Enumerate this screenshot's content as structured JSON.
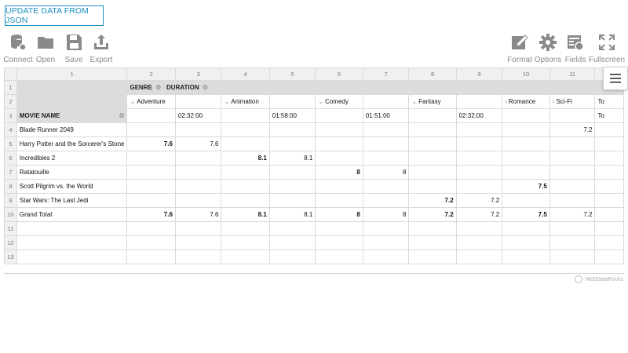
{
  "update_button": "UPDATE DATA FROM JSON",
  "toolbar": {
    "connect": "Connect",
    "open": "Open",
    "save": "Save",
    "export": "Export",
    "format": "Format",
    "options": "Options",
    "fields": "Fields",
    "fullscreen": "Fullscreen"
  },
  "column_numbers": [
    "1",
    "2",
    "3",
    "4",
    "5",
    "6",
    "7",
    "8",
    "9",
    "10",
    "11"
  ],
  "row_numbers": [
    "1",
    "2",
    "3",
    "4",
    "5",
    "6",
    "7",
    "8",
    "9",
    "10",
    "11",
    "12",
    "13"
  ],
  "header": {
    "col_field_genre": "GENRE",
    "col_field_duration": "DURATION",
    "row_field": "MOVIE NAME",
    "total_label_partial": "To"
  },
  "genres": [
    "Adventure",
    "Animation",
    "Comedy",
    "Fantasy",
    "Romance",
    "Sci-Fi"
  ],
  "durations": [
    "02:32:00",
    "01:58:00",
    "01:51:00",
    "02:32:00"
  ],
  "rows": [
    {
      "name": "Blade Runner 2049",
      "cells": [
        "",
        "",
        "",
        "",
        "",
        "",
        "",
        "",
        "",
        "7.2"
      ]
    },
    {
      "name": "Harry Potter and the Sorcerer's Stone",
      "cells": [
        "7.6",
        "7.6",
        "",
        "",
        "",
        "",
        "",
        "",
        "",
        ""
      ]
    },
    {
      "name": "Incredibles 2",
      "cells": [
        "",
        "",
        "8.1",
        "8.1",
        "",
        "",
        "",
        "",
        "",
        ""
      ]
    },
    {
      "name": "Ratatouille",
      "cells": [
        "",
        "",
        "",
        "",
        "8",
        "8",
        "",
        "",
        "",
        ""
      ]
    },
    {
      "name": "Scott Pilgrim vs. the World",
      "cells": [
        "",
        "",
        "",
        "",
        "",
        "",
        "",
        "",
        "7.5",
        ""
      ]
    },
    {
      "name": "Star Wars: The Last Jedi",
      "cells": [
        "",
        "",
        "",
        "",
        "",
        "",
        "7.2",
        "7.2",
        "",
        ""
      ]
    },
    {
      "name": "Grand Total",
      "cells": [
        "7.6",
        "7.6",
        "8.1",
        "8.1",
        "8",
        "8",
        "7.2",
        "7.2",
        "7.5",
        "7.2"
      ]
    }
  ],
  "brand": "WebDataRocks"
}
